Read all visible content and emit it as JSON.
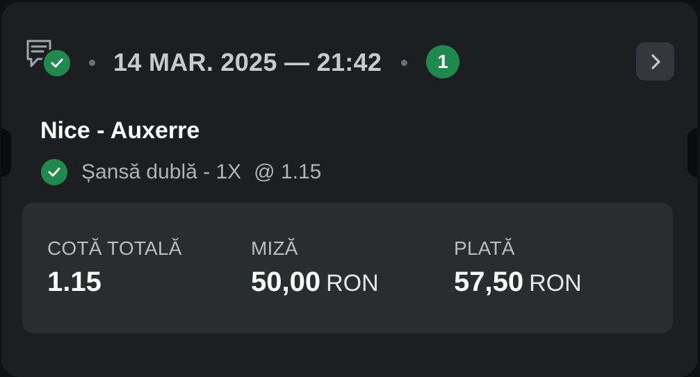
{
  "header": {
    "datetime": "14 MAR. 2025 — 21:42",
    "selections_count": "1",
    "icons": {
      "ticket": "ticket-icon",
      "status": "check-icon",
      "expand": "chevron-right-icon"
    }
  },
  "bet": {
    "match": "Nice - Auxerre",
    "selection": "Șansă dublă - 1X",
    "odds": "@ 1.15"
  },
  "summary": {
    "total_odds_label": "COTĂ TOTALĂ",
    "total_odds_value": "1.15",
    "stake_label": "MIZĂ",
    "stake_value": "50,00",
    "stake_currency": "RON",
    "payout_label": "PLATĂ",
    "payout_value": "57,50",
    "payout_currency": "RON"
  },
  "colors": {
    "background": "#0f1113",
    "card": "#1c1e21",
    "panel": "#2a2d30",
    "success": "#1f8a4d",
    "button": "#34373b"
  }
}
